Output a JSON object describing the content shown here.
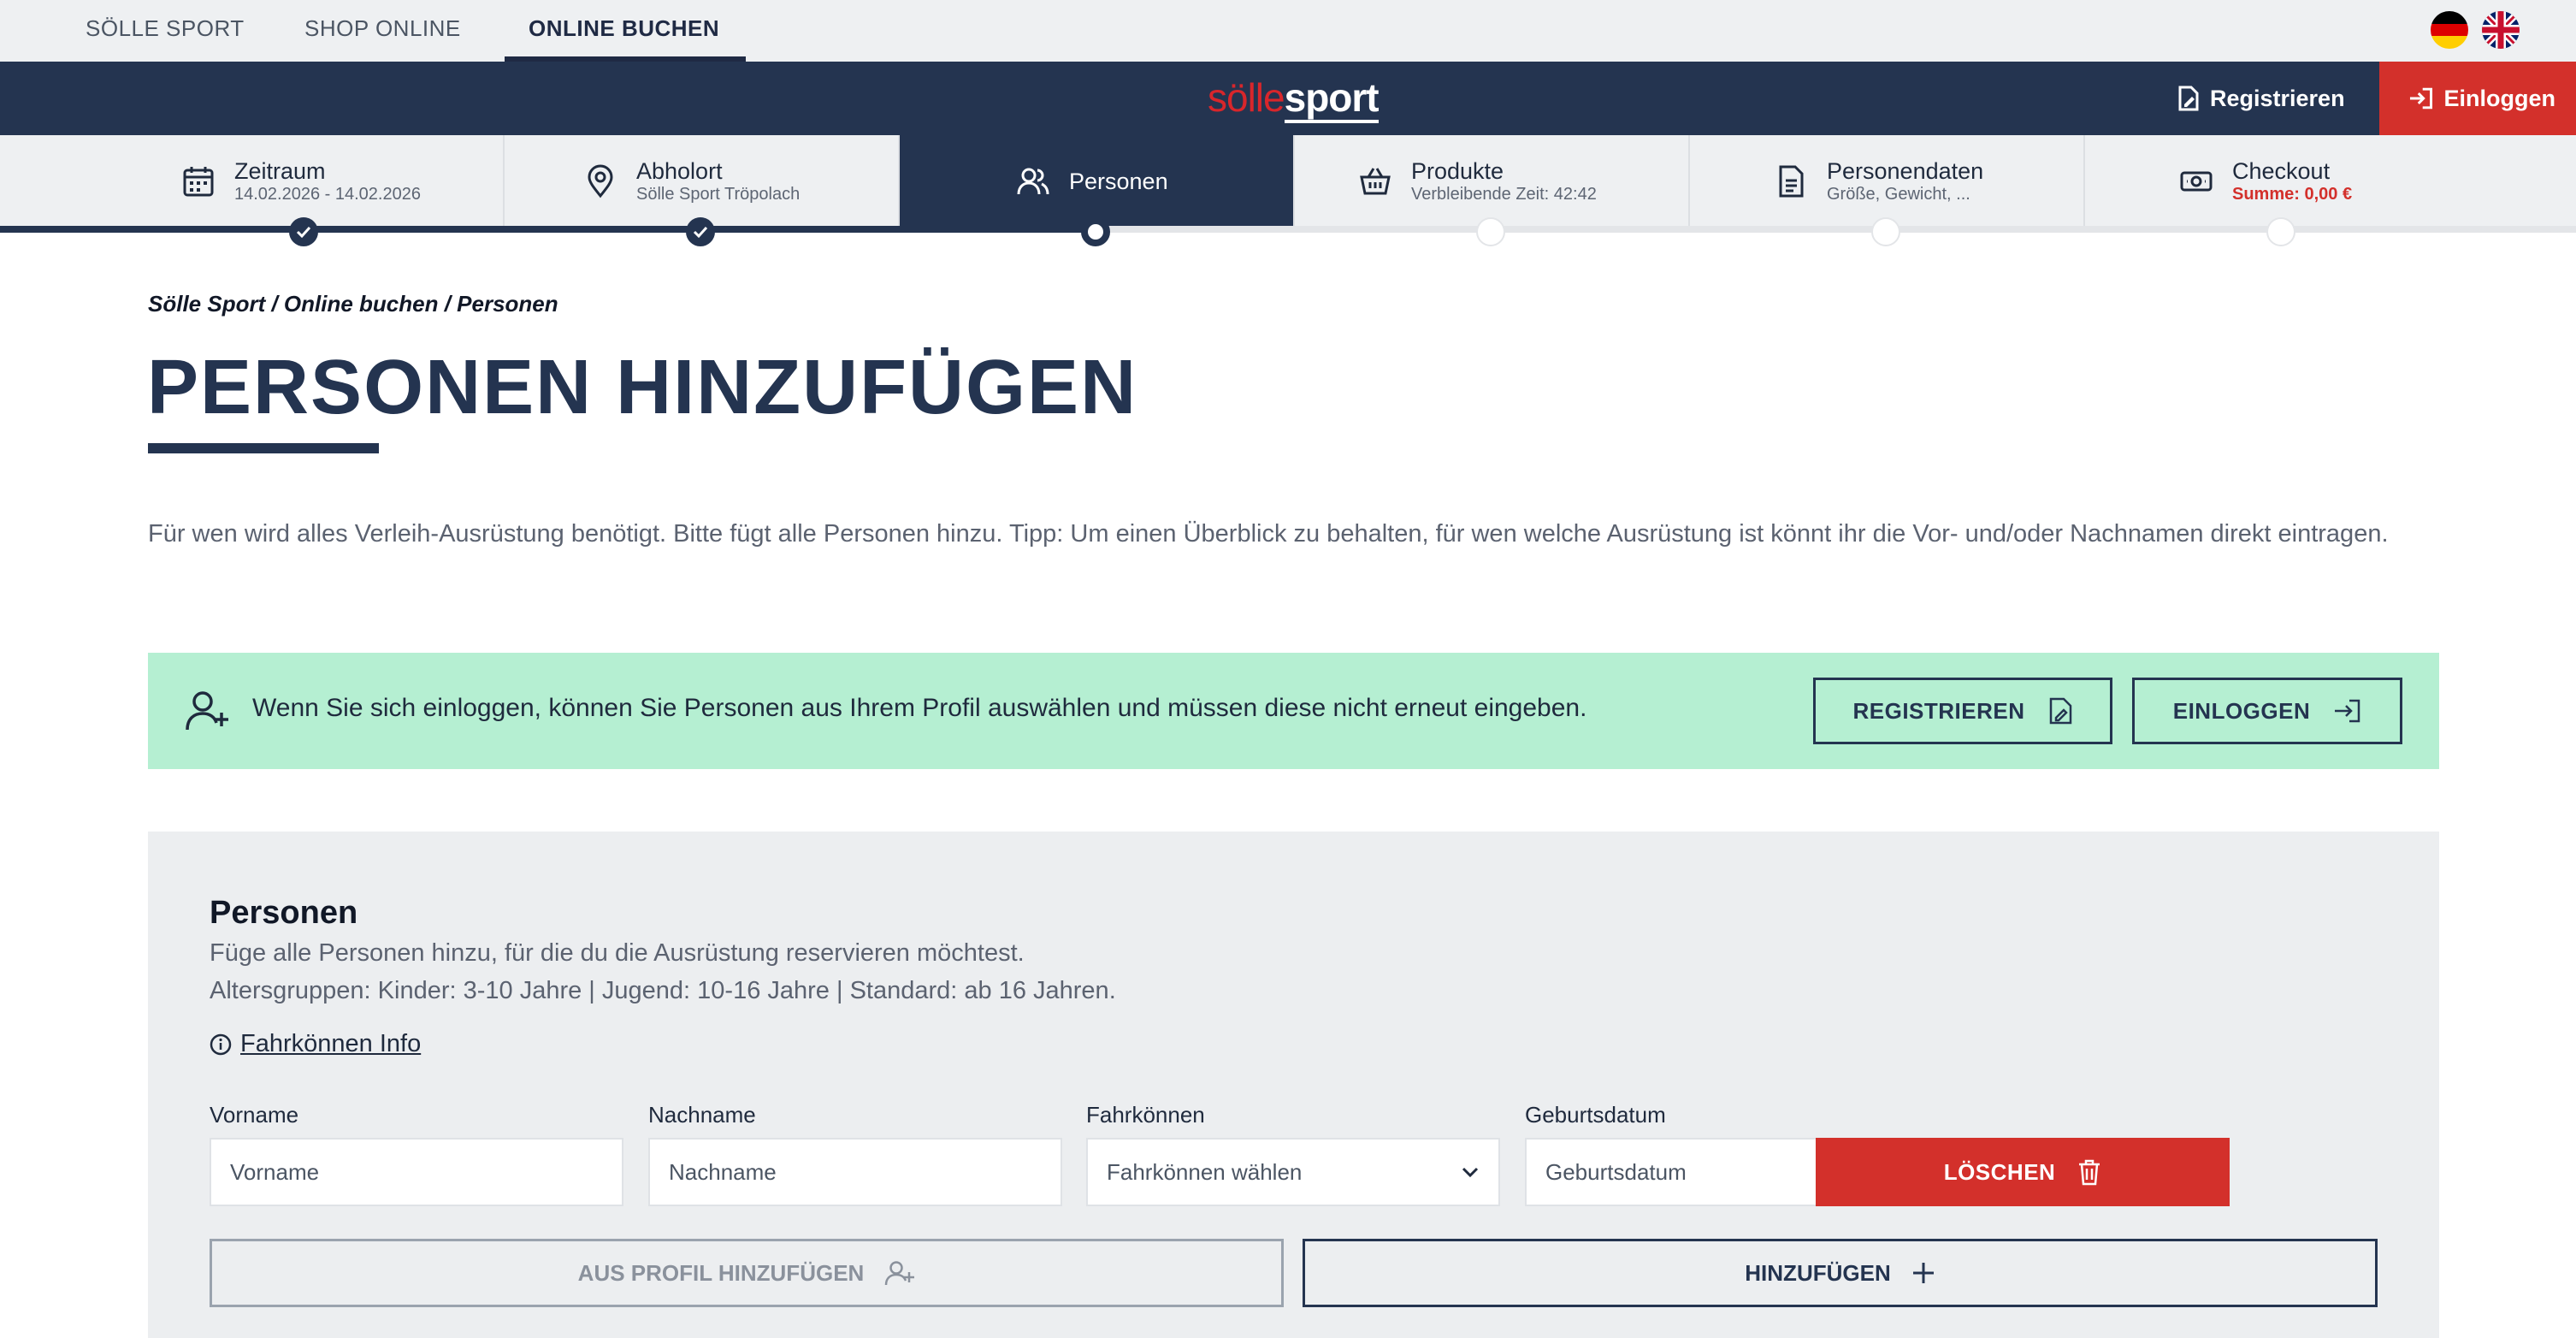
{
  "top_nav": {
    "items": [
      "SÖLLE SPORT",
      "SHOP ONLINE",
      "ONLINE BUCHEN"
    ],
    "active_index": 2
  },
  "languages": [
    {
      "code": "de",
      "icon": "german-flag-icon"
    },
    {
      "code": "en",
      "icon": "uk-flag-icon"
    }
  ],
  "header": {
    "logo_part1": "sölle",
    "logo_part2": "sport",
    "register_label": "Registrieren",
    "login_label": "Einloggen",
    "bg_color": "#243450",
    "accent_color": "#d3302b"
  },
  "steps": [
    {
      "title": "Zeitraum",
      "subtitle": "14.02.2026 - 14.02.2026",
      "icon": "calendar-icon",
      "state": "done"
    },
    {
      "title": "Abholort",
      "subtitle": "Sölle Sport Tröpolach",
      "icon": "map-pin-icon",
      "state": "done"
    },
    {
      "title": "Personen",
      "subtitle": "",
      "icon": "users-icon",
      "state": "current"
    },
    {
      "title": "Produkte",
      "subtitle": "Verbleibende Zeit: 42:42",
      "icon": "basket-icon",
      "state": "todo"
    },
    {
      "title": "Personendaten",
      "subtitle": "Größe, Gewicht, ...",
      "icon": "document-icon",
      "state": "todo"
    },
    {
      "title": "Checkout",
      "subtitle": "Summe: 0,00 €",
      "icon": "cash-icon",
      "state": "todo"
    }
  ],
  "breadcrumb": "Sölle Sport / Online buchen / Personen",
  "page_title": "PERSONEN HINZUFÜGEN",
  "intro": "Für wen wird alles Verleih-Ausrüstung benötigt. Bitte fügt alle Personen hinzu. Tipp: Um einen Überblick zu behalten, für wen welche Ausrüstung ist könnt ihr die Vor- und/oder Nachnamen direkt eintragen.",
  "login_banner": {
    "text": "Wenn Sie sich einloggen, können Sie Personen aus Ihrem Profil auswählen und müssen diese nicht erneut eingeben.",
    "register_button": "REGISTRIEREN",
    "login_button": "EINLOGGEN",
    "bg_color": "#b5efd2"
  },
  "persons_panel": {
    "heading": "Personen",
    "description_line1": "Füge alle Personen hinzu, für die du die Ausrüstung reservieren möchtest.",
    "description_line2": "Altersgruppen: Kinder: 3-10 Jahre | Jugend: 10-16 Jahre | Standard: ab 16 Jahren.",
    "info_link": "Fahrkönnen Info",
    "fields": {
      "firstname": {
        "label": "Vorname",
        "placeholder": "Vorname",
        "value": ""
      },
      "lastname": {
        "label": "Nachname",
        "placeholder": "Nachname",
        "value": ""
      },
      "skill": {
        "label": "Fahrkönnen",
        "selected": "Fahrkönnen wählen"
      },
      "birthdate": {
        "label": "Geburtsdatum",
        "placeholder": "Geburtsdatum",
        "value": ""
      }
    },
    "delete_button": "LÖSCHEN",
    "add_from_profile_button": "AUS PROFIL HINZUFÜGEN",
    "add_button": "HINZUFÜGEN"
  }
}
